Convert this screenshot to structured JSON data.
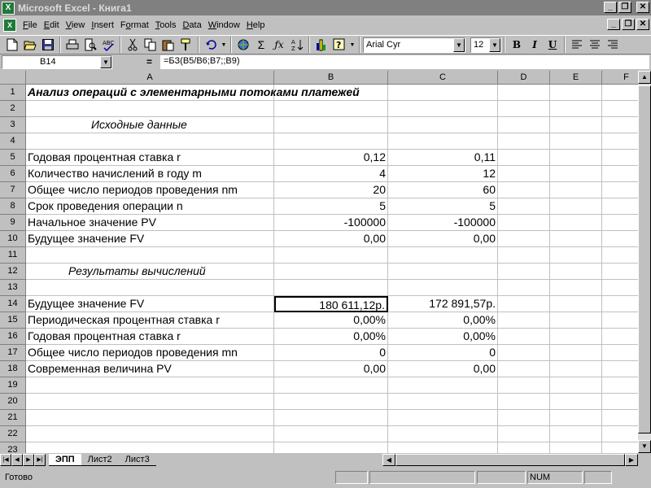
{
  "window": {
    "title": "Microsoft Excel - Книга1",
    "app_icon": "X",
    "minimize": "_",
    "restore": "❐",
    "close": "✕"
  },
  "menu": {
    "items": [
      {
        "label": "File",
        "u": "F"
      },
      {
        "label": "Edit",
        "u": "E"
      },
      {
        "label": "View",
        "u": "V"
      },
      {
        "label": "Insert",
        "u": "I"
      },
      {
        "label": "Format",
        "u": "o"
      },
      {
        "label": "Tools",
        "u": "T"
      },
      {
        "label": "Data",
        "u": "D"
      },
      {
        "label": "Window",
        "u": "W"
      },
      {
        "label": "Help",
        "u": "H"
      }
    ]
  },
  "toolbar": {
    "font_name": "Arial Cyr",
    "font_size": "12",
    "bold": "B",
    "italic": "I",
    "underline": "U"
  },
  "formula_bar": {
    "name_box": "B14",
    "equals": "=",
    "formula": "=БЗ(B5/B6;B7;;B9)"
  },
  "columns": [
    "A",
    "B",
    "C",
    "D",
    "E",
    "F"
  ],
  "rows": [
    "1",
    "2",
    "3",
    "4",
    "5",
    "6",
    "7",
    "8",
    "9",
    "10",
    "11",
    "12",
    "13",
    "14",
    "15",
    "16",
    "17",
    "18",
    "19",
    "20",
    "21",
    "22",
    "23"
  ],
  "cells": {
    "r1": {
      "a": "Анализ операций с элементарными потоками платежей"
    },
    "r3": {
      "a": "Исходные данные"
    },
    "r5": {
      "a": "Годовая процентная ставка r",
      "b": "0,12",
      "c": "0,11"
    },
    "r6": {
      "a": "Количество начислений в году m",
      "b": "4",
      "c": "12"
    },
    "r7": {
      "a": "Общее число периодов проведения nm",
      "b": "20",
      "c": "60"
    },
    "r8": {
      "a": "Срок проведения операции n",
      "b": "5",
      "c": "5"
    },
    "r9": {
      "a": "Начальное значение PV",
      "b": "-100000",
      "c": "-100000"
    },
    "r10": {
      "a": "Будущее значение FV",
      "b": "0,00",
      "c": "0,00"
    },
    "r12": {
      "a": "Результаты вычислений"
    },
    "r14": {
      "a": "Будущее значение FV",
      "b": "180 611,12р.",
      "c": "172 891,57р."
    },
    "r15": {
      "a": "Периодическая процентная ставка r",
      "b": "0,00%",
      "c": "0,00%"
    },
    "r16": {
      "a": "Годовая процентная ставка r",
      "b": "0,00%",
      "c": "0,00%"
    },
    "r17": {
      "a": "Общее число периодов проведения mn",
      "b": "0",
      "c": "0"
    },
    "r18": {
      "a": "Современная величина  PV",
      "b": "0,00",
      "c": "0,00"
    }
  },
  "sheets": {
    "tabs": [
      "ЭПП",
      "Лист2",
      "Лист3"
    ],
    "active": "ЭПП"
  },
  "status": {
    "text": "Готово",
    "num": "NUM"
  }
}
